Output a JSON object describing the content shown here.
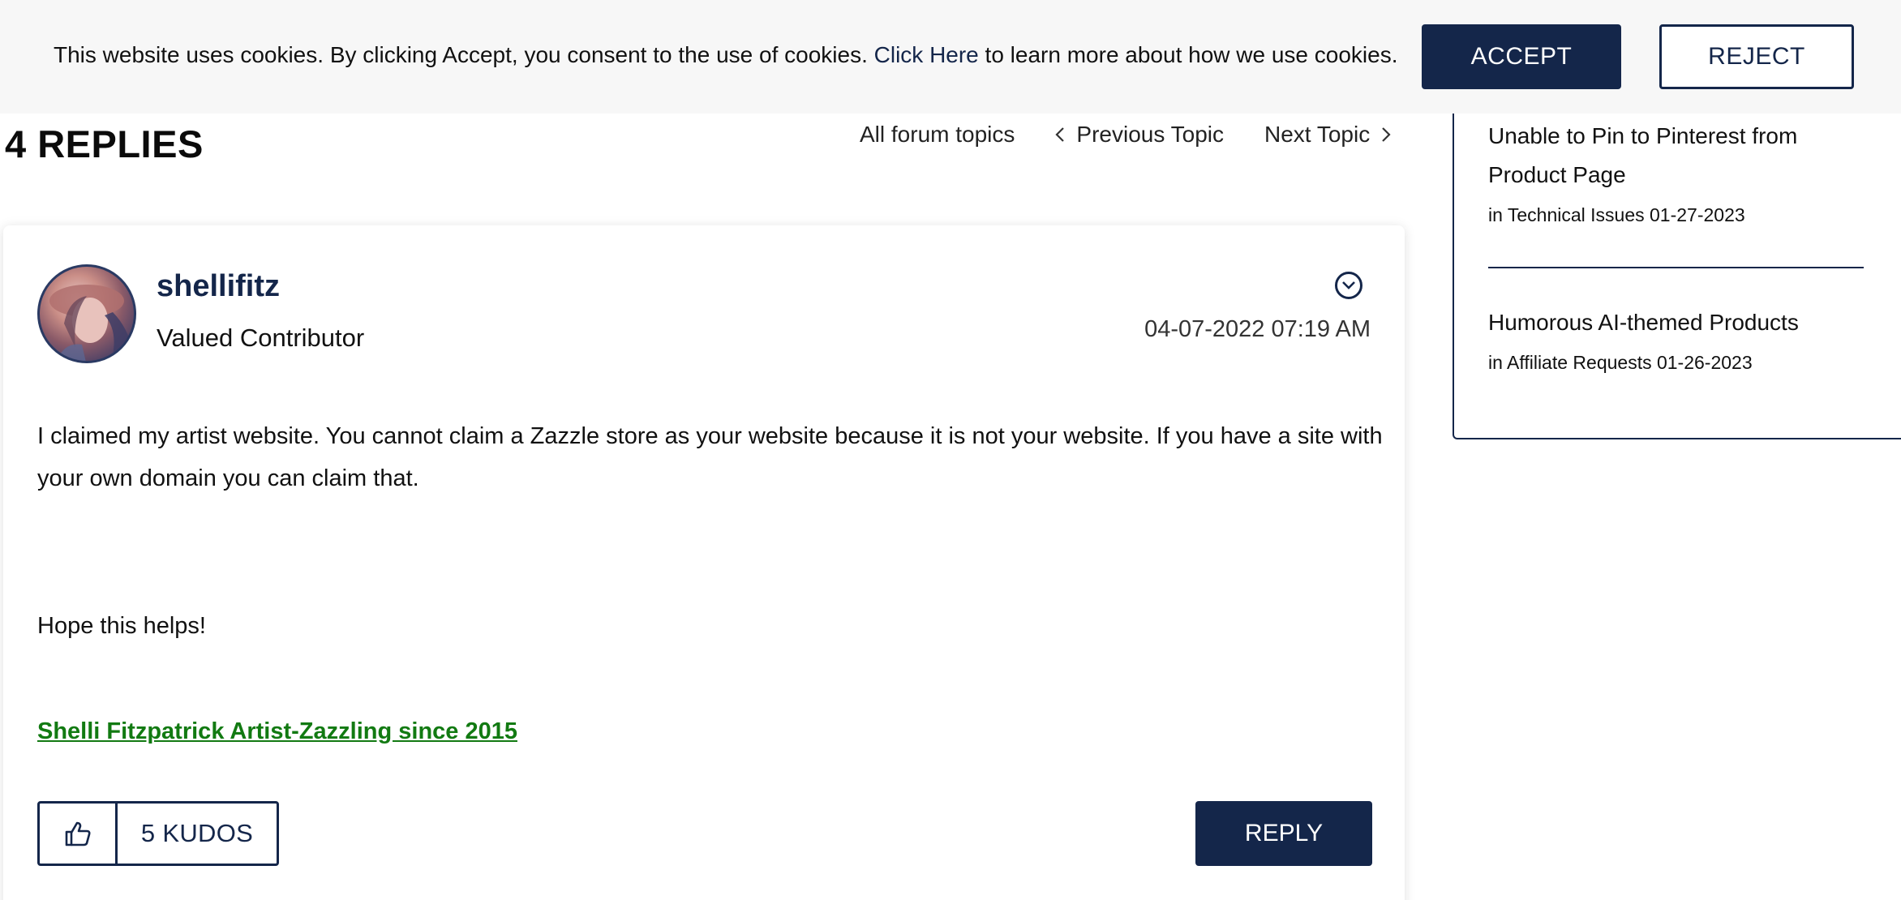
{
  "cookie_banner": {
    "text_before": "This website uses cookies. By clicking Accept, you consent to the use of cookies. ",
    "link_text": "Click Here",
    "text_after": " to learn more about how we use cookies.",
    "accept_label": "ACCEPT",
    "reject_label": "REJECT"
  },
  "replies": {
    "title": "4 REPLIES"
  },
  "topic_nav": {
    "all_topics": "All forum topics",
    "previous": "Previous Topic",
    "next": "Next Topic"
  },
  "post": {
    "author": "shellifitz",
    "rank": "Valued Contributor",
    "date": "04-07-2022 07:19 AM",
    "paragraph_1": "I claimed my artist website. You cannot claim a Zazzle store as your website because it is not your website.   If you have a site with your own domain you can claim that.",
    "paragraph_2": "Hope this helps!",
    "signature": "Shelli Fitzpatrick Artist-Zazzling since 2015",
    "kudos_label": "5 KUDOS",
    "reply_label": "REPLY"
  },
  "sidebar": {
    "items": [
      {
        "title": "Unable to Pin to Pinterest from Product Page",
        "meta": "in Technical Issues 01-27-2023"
      },
      {
        "title": "Humorous AI-themed Products",
        "meta": "in Affiliate Requests 01-26-2023"
      }
    ]
  },
  "icons": {
    "options": "chevron-down-circle-icon",
    "kudos": "thumbs-up-icon",
    "prev": "chevron-left-icon",
    "next": "chevron-right-icon"
  },
  "colors": {
    "brand_navy": "#14264a",
    "signature_green": "#127a12",
    "banner_bg": "#f7f7f7"
  }
}
